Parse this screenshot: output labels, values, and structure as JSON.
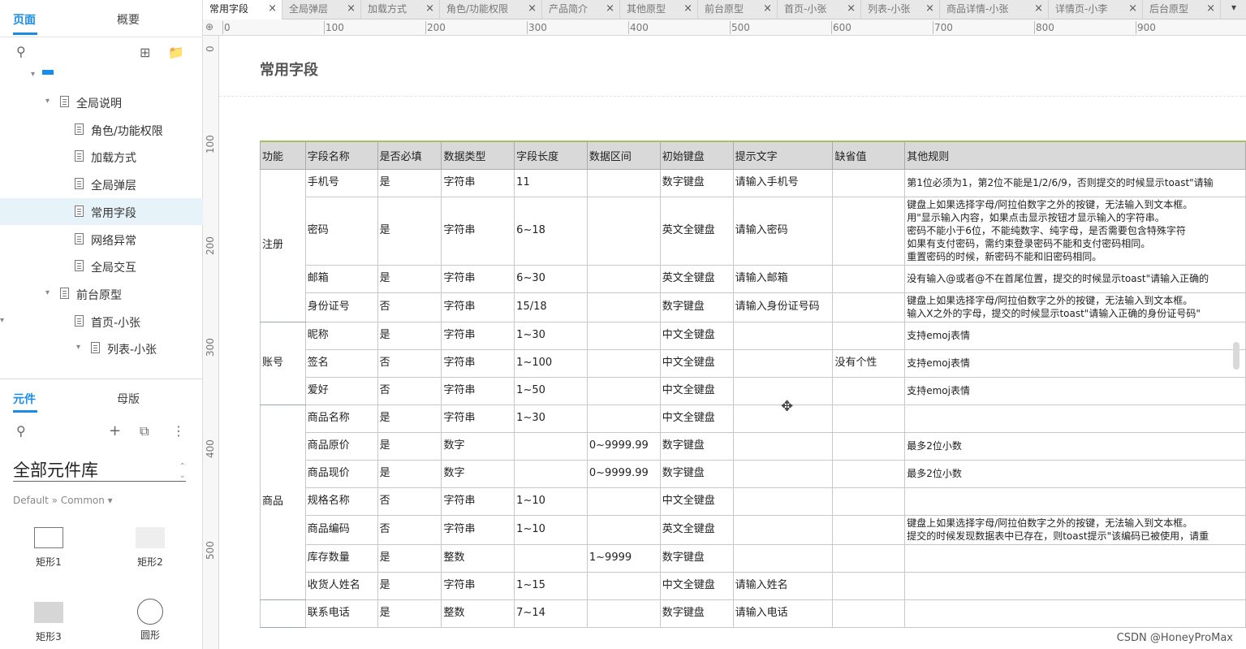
{
  "left_panel": {
    "tabs": [
      {
        "label": "页面"
      },
      {
        "label": "概要"
      }
    ],
    "pages": [
      {
        "label": "全局说明",
        "depth": 1,
        "expanded": true
      },
      {
        "label": "角色/功能权限",
        "depth": 2
      },
      {
        "label": "加载方式",
        "depth": 2
      },
      {
        "label": "全局弹层",
        "depth": 2
      },
      {
        "label": "常用字段",
        "depth": 2,
        "selected": true
      },
      {
        "label": "网络异常",
        "depth": 2
      },
      {
        "label": "全局交互",
        "depth": 2
      },
      {
        "label": "前台原型",
        "depth": 1,
        "expanded": true
      },
      {
        "label": "首页-小张",
        "depth": 2,
        "expanded": true
      },
      {
        "label": "列表-小张",
        "depth": 3,
        "expanded": true
      }
    ],
    "widget_tabs": [
      {
        "label": "元件"
      },
      {
        "label": "母版"
      }
    ],
    "library": {
      "name": "全部元件库",
      "sub": "Default » Common ▾"
    },
    "widgets": [
      {
        "label": "矩形1"
      },
      {
        "label": "矩形2"
      },
      {
        "label": "矩形3"
      },
      {
        "label": "圆形"
      }
    ]
  },
  "doc_tabs": [
    {
      "label": "常用字段",
      "active": true
    },
    {
      "label": "全局弹层"
    },
    {
      "label": "加载方式"
    },
    {
      "label": "角色/功能权限"
    },
    {
      "label": "产品简介"
    },
    {
      "label": "其他原型"
    },
    {
      "label": "前台原型"
    },
    {
      "label": "首页-小张"
    },
    {
      "label": "列表-小张"
    },
    {
      "label": "商品详情-小张"
    },
    {
      "label": "详情页-小李"
    },
    {
      "label": "后台原型"
    }
  ],
  "ruler": {
    "h_labels": [
      "0",
      "100",
      "200",
      "300",
      "400",
      "500",
      "600",
      "700",
      "800",
      "900"
    ],
    "v_labels": [
      "0",
      "100",
      "200",
      "300",
      "400",
      "500"
    ]
  },
  "page_title": "常用字段",
  "table": {
    "headers": [
      "功能",
      "字段名称",
      "是否必填",
      "数据类型",
      "字段长度",
      "数据区间",
      "初始键盘",
      "提示文字",
      "缺省值",
      "其他规则"
    ],
    "groups": [
      {
        "category": "注册",
        "rows": [
          [
            "手机号",
            "是",
            "字符串",
            "11",
            "",
            "数字键盘",
            "请输入手机号",
            "",
            "第1位必须为1，第2位不能是1/2/6/9，否则提交的时候显示toast\"请输"
          ],
          [
            "密码",
            "是",
            "字符串",
            "6~18",
            "",
            "英文全键盘",
            "请输入密码",
            "",
            "键盘上如果选择字母/阿拉伯数字之外的按键，无法输入到文本框。\n用\"显示输入内容，如果点击显示按钮才显示输入的字符串。\n密码不能小于6位，不能纯数字、纯字母，是否需要包含特殊字符\n如果有支付密码，需约束登录密码不能和支付密码相同。\n重置密码的时候，新密码不能和旧密码相同。"
          ],
          [
            "邮箱",
            "是",
            "字符串",
            "6~30",
            "",
            "英文全键盘",
            "请输入邮箱",
            "",
            "没有输入@或者@不在首尾位置，提交的时候显示toast\"请输入正确的"
          ],
          [
            "身份证号",
            "否",
            "字符串",
            "15/18",
            "",
            "数字键盘",
            "请输入身份证号码",
            "",
            "键盘上如果选择字母/阿拉伯数字之外的按键，无法输入到文本框。\n输入X之外的字母，提交的时候显示toast\"请输入正确的身份证号码\""
          ]
        ]
      },
      {
        "category": "账号",
        "rows": [
          [
            "昵称",
            "是",
            "字符串",
            "1~30",
            "",
            "中文全键盘",
            "",
            "",
            "支持emoj表情"
          ],
          [
            "签名",
            "否",
            "字符串",
            "1~100",
            "",
            "中文全键盘",
            "",
            "没有个性",
            "支持emoj表情"
          ],
          [
            "爱好",
            "否",
            "字符串",
            "1~50",
            "",
            "中文全键盘",
            "",
            "",
            "支持emoj表情"
          ]
        ]
      },
      {
        "category": "商品",
        "rows": [
          [
            "商品名称",
            "是",
            "字符串",
            "1~30",
            "",
            "中文全键盘",
            "",
            "",
            ""
          ],
          [
            "商品原价",
            "是",
            "数字",
            "",
            "0~9999.99",
            "数字键盘",
            "",
            "",
            "最多2位小数"
          ],
          [
            "商品现价",
            "是",
            "数字",
            "",
            "0~9999.99",
            "数字键盘",
            "",
            "",
            "最多2位小数"
          ],
          [
            "规格名称",
            "否",
            "字符串",
            "1~10",
            "",
            "中文全键盘",
            "",
            "",
            ""
          ],
          [
            "商品编码",
            "否",
            "字符串",
            "1~10",
            "",
            "英文全键盘",
            "",
            "",
            "键盘上如果选择字母/阿拉伯数字之外的按键，无法输入到文本框。\n提交的时候发现数据表中已存在，则toast提示\"该编码已被使用，请重"
          ],
          [
            "库存数量",
            "是",
            "整数",
            "",
            "1~9999",
            "数字键盘",
            "",
            "",
            ""
          ],
          [
            "收货人姓名",
            "是",
            "字符串",
            "1~15",
            "",
            "中文全键盘",
            "请输入姓名",
            "",
            ""
          ]
        ]
      },
      {
        "category": "",
        "rows": [
          [
            "联系电话",
            "是",
            "整数",
            "7~14",
            "",
            "数字键盘",
            "请输入电话",
            "",
            ""
          ]
        ]
      }
    ]
  },
  "watermark": "CSDN @HoneyProMax",
  "colors": {
    "accent": "#1a8ce8",
    "selected_row": "#e6f4fa",
    "table_header": "#d9d9d9",
    "table_border_top": "#a8c060"
  }
}
